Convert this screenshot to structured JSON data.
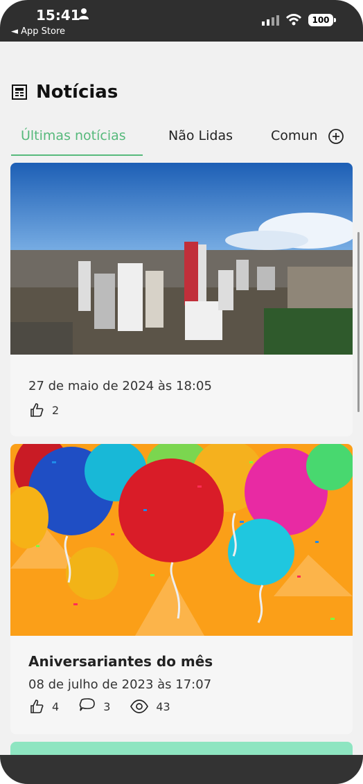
{
  "status": {
    "time": "15:41",
    "back_label": "◄ App Store",
    "battery": "100"
  },
  "header": {
    "title": "Notícias",
    "icon": "newspaper-icon"
  },
  "tabs": [
    {
      "label": "Últimas notícias",
      "active": true
    },
    {
      "label": "Não Lidas",
      "active": false
    },
    {
      "label": "Comun",
      "active": false
    }
  ],
  "posts": [
    {
      "title": "",
      "date": "27 de maio de 2024 às 18:05",
      "likes": "2",
      "image": "city-skyline-image"
    },
    {
      "title": "Aniversariantes do mês",
      "date": "08 de julho de 2023 às 17:07",
      "likes": "4",
      "comments": "3",
      "views": "43",
      "image": "balloons-image"
    }
  ],
  "colors": {
    "accent": "#56b97b",
    "status_bar": "#2f2f2f",
    "bottom_bar": "#333333",
    "next_card": "#8ee5c1"
  }
}
